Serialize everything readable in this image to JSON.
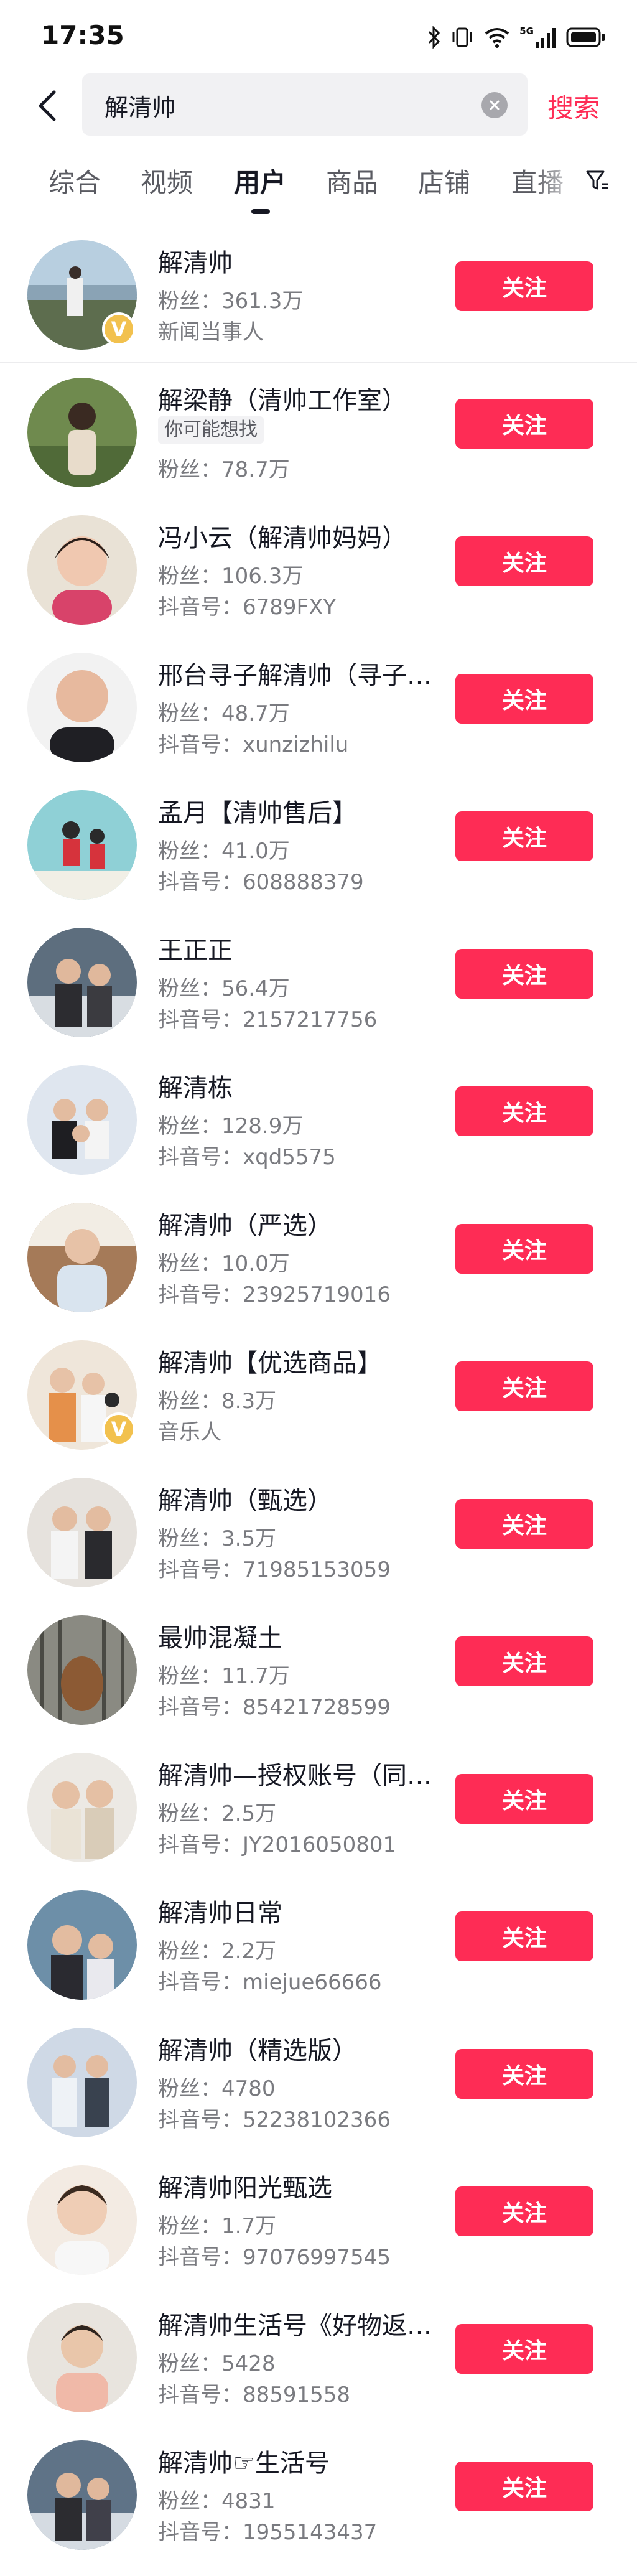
{
  "status_bar": {
    "time": "17:35",
    "network_label": "5G"
  },
  "search": {
    "query": "解清帅",
    "submit_label": "搜索"
  },
  "tabs": [
    "综合",
    "视频",
    "用户",
    "商品",
    "店铺",
    "直播"
  ],
  "active_tab": "用户",
  "colors": {
    "accent": "#fe2c55",
    "verified": "#f2c14e"
  },
  "users": [
    {
      "name": "解清帅",
      "fans": "粉丝：361.3万",
      "extra": "新闻当事人",
      "verified": true,
      "follow_label": "关注"
    },
    {
      "name": "解梁静（清帅工作室）",
      "suggest_tag": "你可能想找",
      "fans": "粉丝：78.7万",
      "follow_label": "关注"
    },
    {
      "name": "冯小云（解清帅妈妈）",
      "fans": "粉丝：106.3万",
      "extra": "抖音号：6789FXY",
      "follow_label": "关注"
    },
    {
      "name": "邢台寻子解清帅（寻子…",
      "fans": "粉丝：48.7万",
      "extra": "抖音号：xunzizhilu",
      "follow_label": "关注"
    },
    {
      "name": "孟月【清帅售后】",
      "fans": "粉丝：41.0万",
      "extra": "抖音号：608888379",
      "follow_label": "关注"
    },
    {
      "name": "王正正",
      "fans": "粉丝：56.4万",
      "extra": "抖音号：2157217756",
      "follow_label": "关注"
    },
    {
      "name": "解清栋",
      "fans": "粉丝：128.9万",
      "extra": "抖音号：xqd5575",
      "follow_label": "关注"
    },
    {
      "name": "解清帅（严选）",
      "fans": "粉丝：10.0万",
      "extra": "抖音号：23925719016",
      "follow_label": "关注"
    },
    {
      "name": "解清帅【优选商品】",
      "fans": "粉丝：8.3万",
      "extra": "音乐人",
      "verified": true,
      "follow_label": "关注"
    },
    {
      "name": "解清帅（甄选）",
      "fans": "粉丝：3.5万",
      "extra": "抖音号：71985153059",
      "follow_label": "关注"
    },
    {
      "name": "最帅混凝土",
      "fans": "粉丝：11.7万",
      "extra": "抖音号：85421728599",
      "follow_label": "关注"
    },
    {
      "name": "解清帅—授权账号（同…",
      "fans": "粉丝：2.5万",
      "extra": "抖音号：JY2016050801",
      "follow_label": "关注"
    },
    {
      "name": "解清帅日常",
      "fans": "粉丝：2.2万",
      "extra": "抖音号：miejue66666",
      "follow_label": "关注"
    },
    {
      "name": "解清帅（精选版）",
      "fans": "粉丝：4780",
      "extra": "抖音号：52238102366",
      "follow_label": "关注"
    },
    {
      "name": "解清帅阳光甄选",
      "fans": "粉丝：1.7万",
      "extra": "抖音号：97076997545",
      "follow_label": "关注"
    },
    {
      "name": "解清帅生活号《好物返…",
      "fans": "粉丝：5428",
      "extra": "抖音号：88591558",
      "follow_label": "关注"
    },
    {
      "name": "解清帅☞生活号",
      "fans": "粉丝：4831",
      "extra": "抖音号：1955143437",
      "follow_label": "关注"
    }
  ]
}
